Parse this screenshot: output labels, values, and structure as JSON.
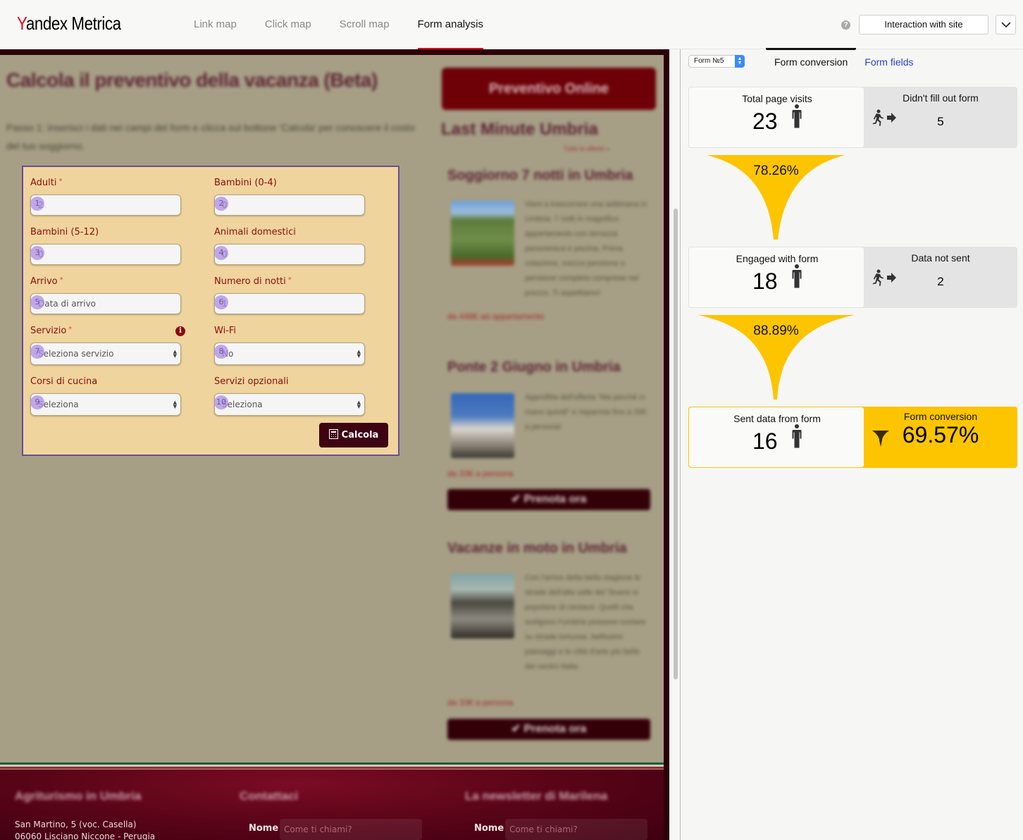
{
  "header": {
    "logo_y": "Y",
    "logo_andex": "andex",
    "logo_metrica": " Metrica",
    "nav": [
      {
        "label": "Link map",
        "active": false
      },
      {
        "label": "Click map",
        "active": false
      },
      {
        "label": "Scroll map",
        "active": false
      },
      {
        "label": "Form analysis",
        "active": true
      }
    ],
    "help_icon": "question-icon",
    "mode_button": "Interaction with site",
    "mode_dropdown_icon": "chevron-down-icon"
  },
  "site": {
    "title": "Calcola il preventivo della vacanza (Beta)",
    "intro": "Passo 1: inserisci i dati nei campi del form e clicca sul bottone 'Calcola' per conoscere il costo del tuo soggiorno.",
    "form": {
      "fields": [
        {
          "badge": "1",
          "label": "Adulti",
          "required": true,
          "value": "2",
          "type": "input"
        },
        {
          "badge": "2",
          "label": "Bambini (0-4)",
          "required": false,
          "value": "0",
          "type": "input"
        },
        {
          "badge": "3",
          "label": "Bambini (5-12)",
          "required": false,
          "value": "0",
          "type": "input"
        },
        {
          "badge": "4",
          "label": "Animali domestici",
          "required": false,
          "value": "0",
          "type": "input"
        },
        {
          "badge": "5",
          "label": "Arrivo",
          "required": true,
          "value": "",
          "placeholder": "Data di arrivo",
          "type": "input"
        },
        {
          "badge": "6",
          "label": "Numero di notti",
          "required": true,
          "value": "1",
          "type": "input"
        },
        {
          "badge": "7",
          "label": "Servizio",
          "required": true,
          "value": "Seleziona servizio",
          "type": "select",
          "info_icon": true
        },
        {
          "badge": "8",
          "label": "Wi-Fi",
          "required": false,
          "value": "No",
          "type": "select"
        },
        {
          "badge": "9",
          "label": "Corsi di cucina",
          "required": false,
          "value": "Seleziona",
          "type": "select"
        },
        {
          "badge": "10",
          "label": "Servizi opzionali",
          "required": false,
          "value": "Seleziona",
          "type": "select"
        }
      ],
      "required_mark": "*",
      "submit_label": "Calcola"
    },
    "sidebar": {
      "preventivo_button": "Preventivo Online",
      "last_minute_title": "Last Minute Umbria",
      "last_minute_link": "Tutte le offerte »",
      "offers": [
        {
          "title": "Soggiorno 7 notti in Umbria",
          "text": "Vieni a trascorrere una settimana in Umbria: 7 notti in magnifico appartamento con terrazza panoramica e piscina. Prima colazione, mezza pensione o pensione completa comprese nel prezzo. Ti aspettiamo!",
          "price": "da 448€ ad appartamento",
          "button": ""
        },
        {
          "title": "Ponte 2 Giugno in Umbria",
          "text": "Approfitta dell'offerta \"Ma perché ci mano quindi\" e risparmia fino a 33€ a persona!",
          "price": "da 33€ a persona",
          "button": "Prenota ora"
        },
        {
          "title": "Vacanze in moto in Umbria",
          "text": "Con l'arrivo della bella stagione le strade dell'alta valle del Tevere si popolano di centauri. Quelli che scelgono l'Umbria possono contare su strade tortuose, bellissimi paesaggi e le città d'arte più belle del centro Italia.",
          "price": "da 33€ a persona",
          "button": "Prenota ora"
        }
      ]
    },
    "footer": {
      "col1_title": "Agriturismo in Umbria",
      "col2_title": "Contattaci",
      "col3_title": "La newsletter di Marilena",
      "address_line1": "San Martino, 5 (voc. Casella)",
      "address_line2": "06060 Lisciano Niccone - Perugia",
      "name_label": "Nome",
      "name_placeholder": "Come ti chiami?"
    }
  },
  "panel": {
    "form_selector": "Form №5",
    "tabs": [
      {
        "label": "Form conversion",
        "active": true
      },
      {
        "label": "Form fields",
        "active": false
      }
    ],
    "funnel": {
      "total_visits": {
        "label": "Total page visits",
        "value": "23"
      },
      "didnt_fill": {
        "label": "Didn't fill out form",
        "value": "5"
      },
      "step1_pct": "78.26%",
      "engaged": {
        "label": "Engaged with form",
        "value": "18"
      },
      "not_sent": {
        "label": "Data not sent",
        "value": "2"
      },
      "step2_pct": "88.89%",
      "sent": {
        "label": "Sent data from form",
        "value": "16"
      },
      "conversion": {
        "label": "Form conversion",
        "value": "69.57%"
      }
    },
    "colors": {
      "accent_yellow": "#fdc400",
      "link_blue": "#2a3fc8",
      "nav_active_red": "#e4001b"
    }
  }
}
